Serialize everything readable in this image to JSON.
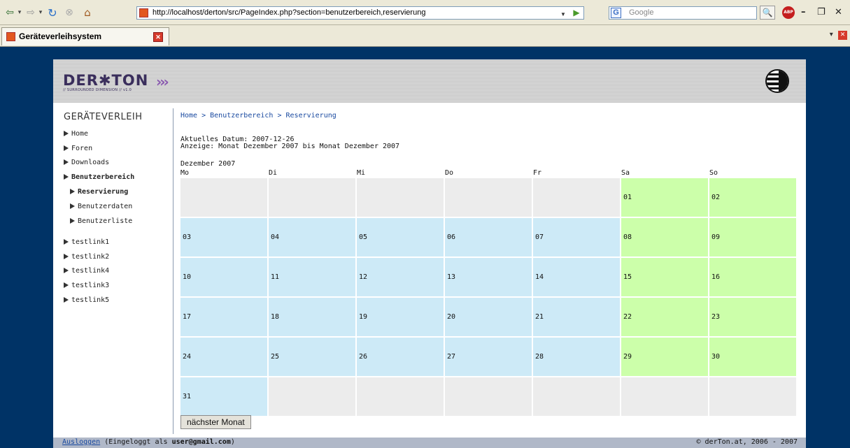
{
  "browser": {
    "url": "http://localhost/derton/src/PageIndex.php?section=benutzerbereich,reservierung",
    "search_placeholder": "Google",
    "search_engine_icon": "G",
    "tab_title": "Geräteverleihsystem",
    "adblock_label": "ABP"
  },
  "header": {
    "logo_text": "DER✱TON",
    "logo_subtitle": "// SURROUNDED DIMENSION // v1.0",
    "logo_arrows": "›››"
  },
  "sidebar": {
    "title": "GERÄTEVERLEIH",
    "items": [
      {
        "label": "Home",
        "bold": false
      },
      {
        "label": "Foren",
        "bold": false
      },
      {
        "label": "Downloads",
        "bold": false
      },
      {
        "label": "Benutzerbereich",
        "bold": true
      },
      {
        "label": "Reservierung",
        "bold": true
      },
      {
        "label": "Benutzerdaten",
        "bold": false
      },
      {
        "label": "Benutzerliste",
        "bold": false
      },
      {
        "label": "testlink1",
        "bold": false
      },
      {
        "label": "testlink2",
        "bold": false
      },
      {
        "label": "testlink4",
        "bold": false
      },
      {
        "label": "testlink3",
        "bold": false
      },
      {
        "label": "testlink5",
        "bold": false
      }
    ]
  },
  "content": {
    "breadcrumb": "Home > Benutzerbereich > Reservierung",
    "current_date": "Aktuelles Datum: 2007-12-26",
    "display_range": "Anzeige: Monat Dezember 2007 bis Monat Dezember 2007",
    "month_title": "Dezember 2007",
    "weekdays": [
      "Mo",
      "Di",
      "Mi",
      "Do",
      "Fr",
      "Sa",
      "So"
    ],
    "calendar_rows": [
      [
        "",
        "",
        "",
        "",
        "",
        "01",
        "02"
      ],
      [
        "03",
        "04",
        "05",
        "06",
        "07",
        "08",
        "09"
      ],
      [
        "10",
        "11",
        "12",
        "13",
        "14",
        "15",
        "16"
      ],
      [
        "17",
        "18",
        "19",
        "20",
        "21",
        "22",
        "23"
      ],
      [
        "24",
        "25",
        "26",
        "27",
        "28",
        "29",
        "30"
      ],
      [
        "31",
        "",
        "",
        "",
        "",
        "",
        ""
      ]
    ],
    "next_month_button": "nächster Monat"
  },
  "colors": {
    "weekday_cell": "#cdeaf7",
    "weekend_cell": "#ccffaa",
    "empty_cell": "#ececec",
    "background": "#003366"
  },
  "footer": {
    "logout_link": "Ausloggen",
    "logged_in_prefix": "(Eingeloggt als",
    "user_email": "user@gmail.com",
    "logged_in_suffix": ")",
    "copyright": "© derTon.at, 2006 - 2007"
  }
}
